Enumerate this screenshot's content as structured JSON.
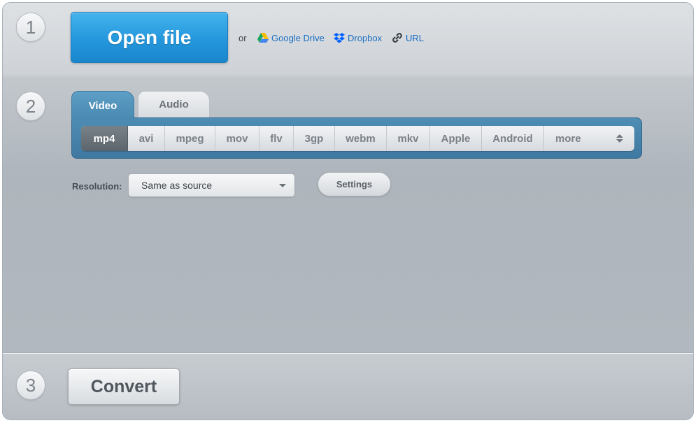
{
  "steps": {
    "one": "1",
    "two": "2",
    "three": "3"
  },
  "open": {
    "button_label": "Open file",
    "or_text": "or",
    "google_drive": "Google Drive",
    "dropbox": "Dropbox",
    "url": "URL"
  },
  "tabs": {
    "video": "Video",
    "audio": "Audio"
  },
  "formats": [
    {
      "label": "mp4",
      "active": true
    },
    {
      "label": "avi",
      "active": false
    },
    {
      "label": "mpeg",
      "active": false
    },
    {
      "label": "mov",
      "active": false
    },
    {
      "label": "flv",
      "active": false
    },
    {
      "label": "3gp",
      "active": false
    },
    {
      "label": "webm",
      "active": false
    },
    {
      "label": "mkv",
      "active": false
    },
    {
      "label": "Apple",
      "active": false
    },
    {
      "label": "Android",
      "active": false
    },
    {
      "label": "more",
      "active": false
    }
  ],
  "resolution": {
    "label": "Resolution:",
    "value": "Same as source"
  },
  "settings_label": "Settings",
  "convert_label": "Convert",
  "colors": {
    "accent": "#2497dc",
    "link": "#1a6fc4",
    "tab_active": "#4f8db5"
  }
}
